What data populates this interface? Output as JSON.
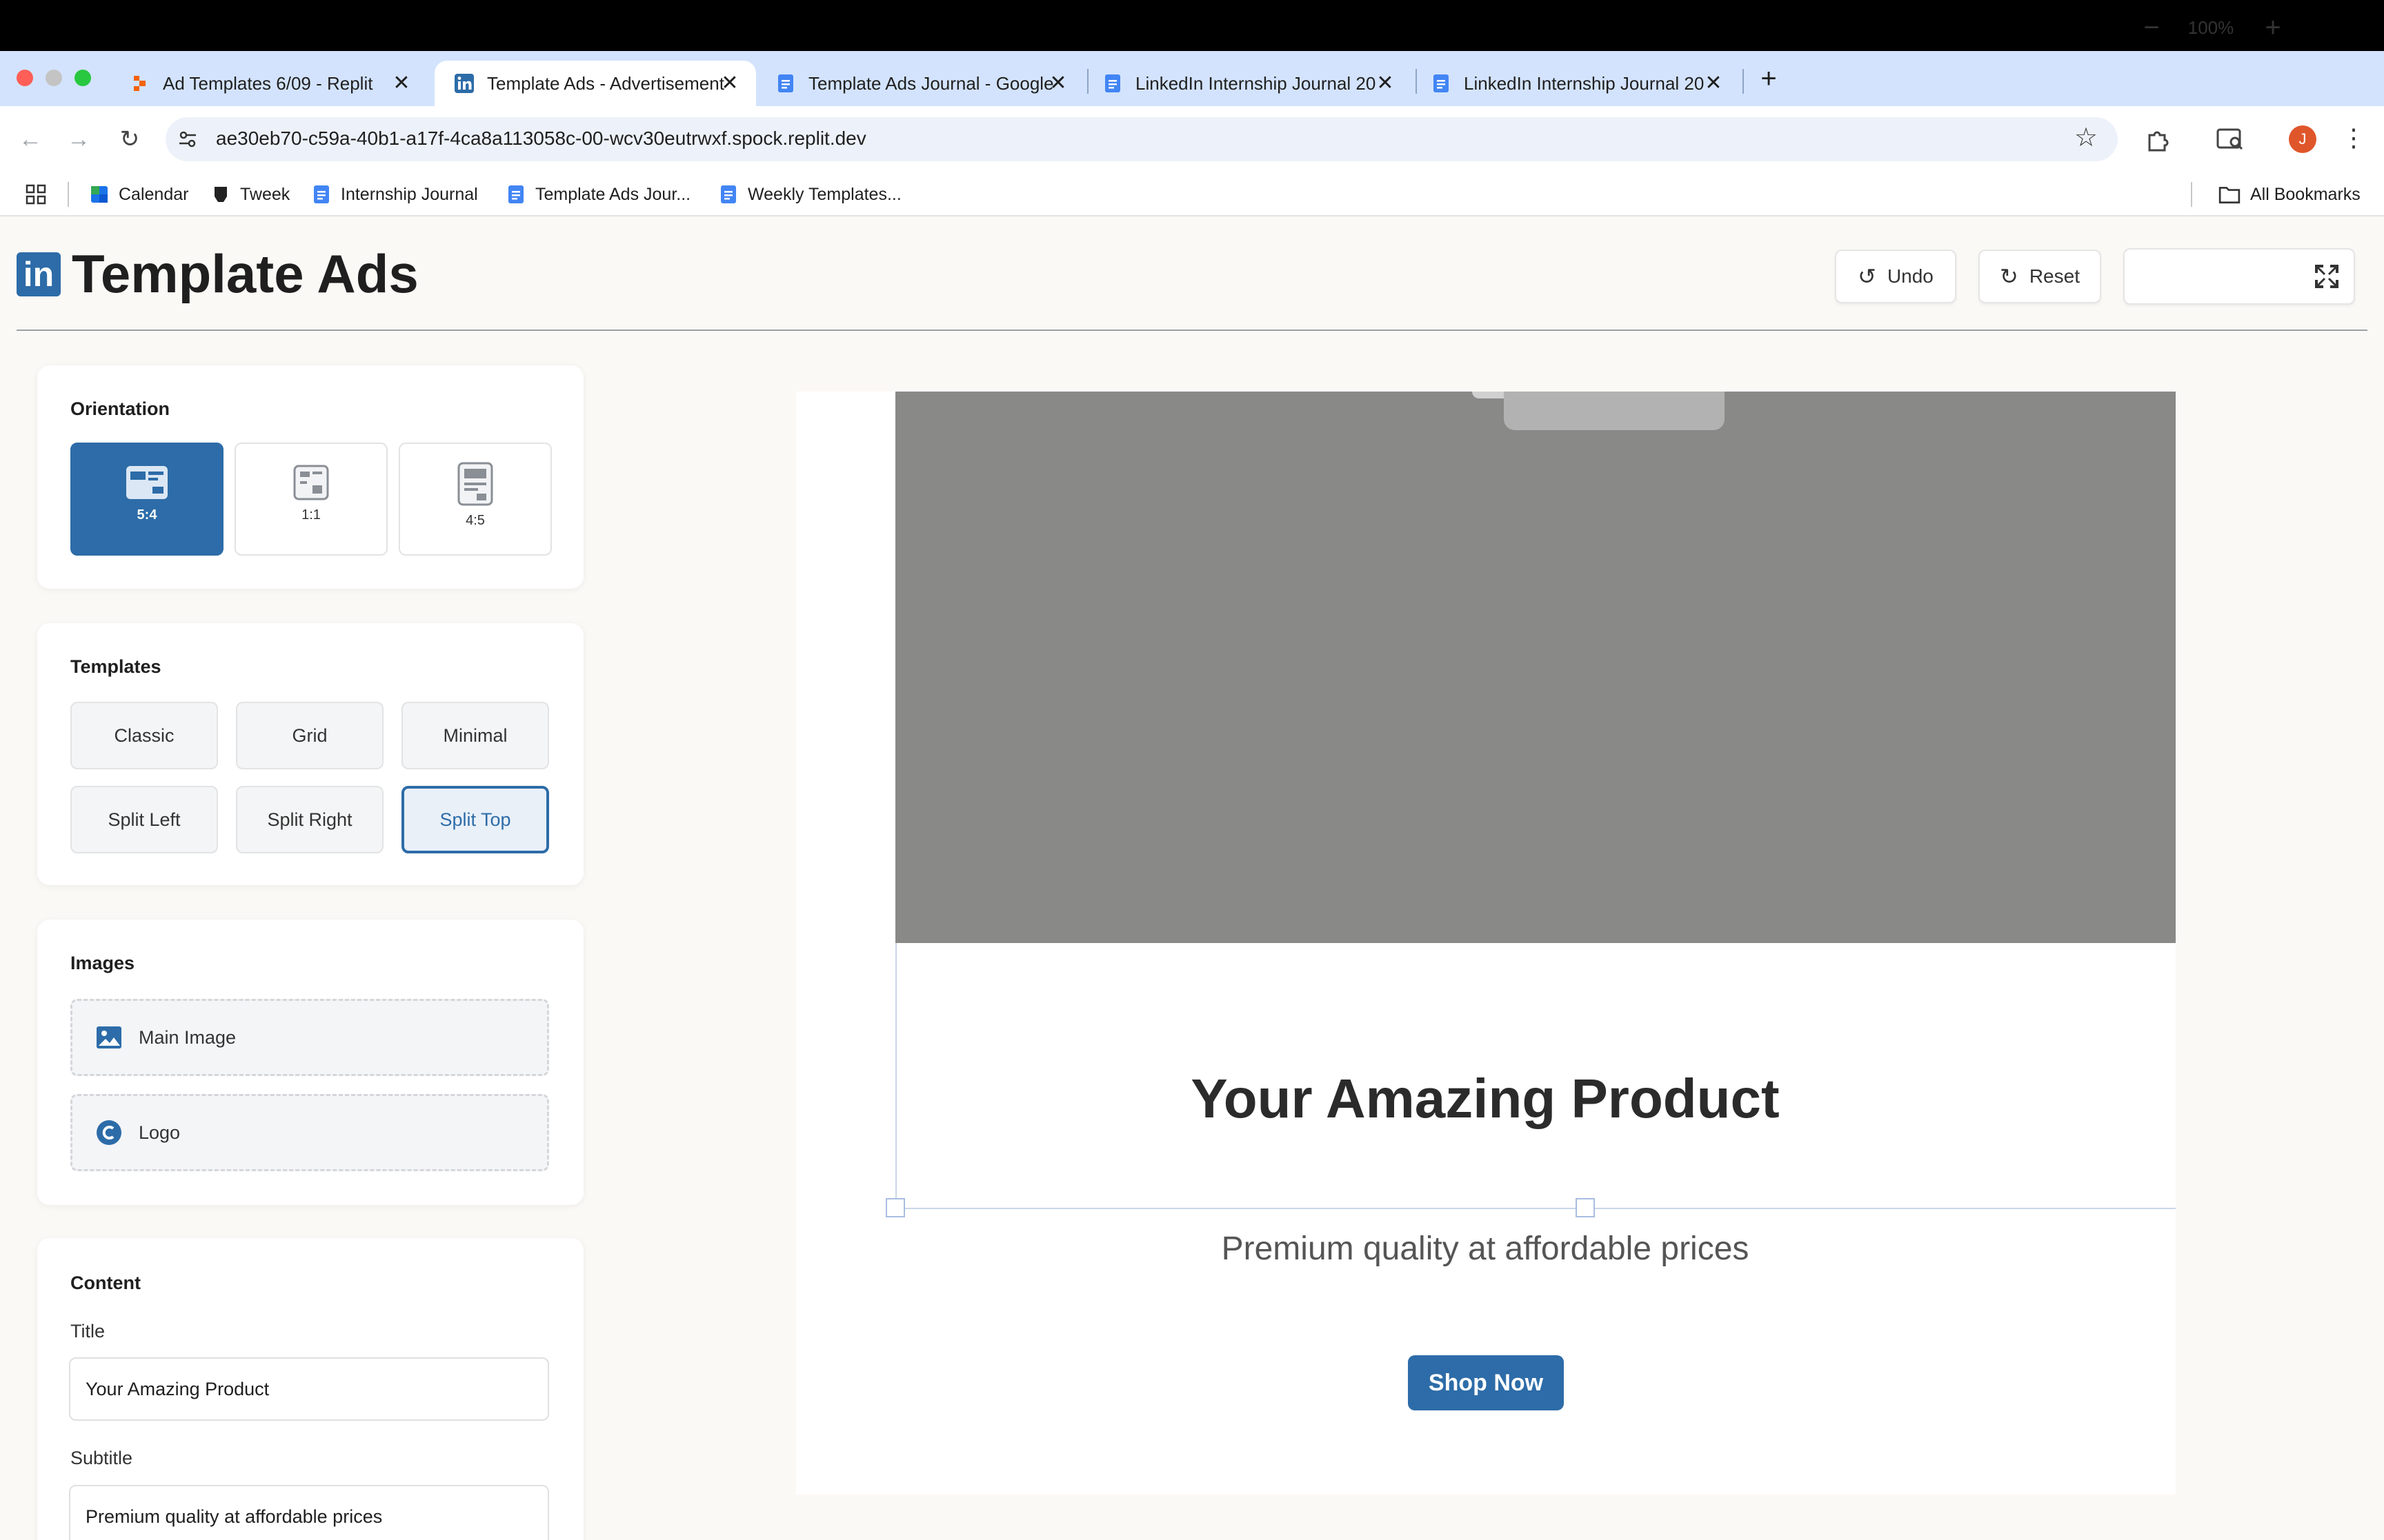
{
  "browser": {
    "tabs": [
      {
        "title": "Ad Templates 6/09 - Replit",
        "icon": "replit-icon",
        "active": false
      },
      {
        "title": "Template Ads - Advertisement",
        "icon": "linkedin-icon",
        "active": true
      },
      {
        "title": "Template Ads Journal - Google",
        "icon": "google-docs-icon",
        "active": false
      },
      {
        "title": "LinkedIn Internship Journal 20",
        "icon": "google-docs-icon",
        "active": false
      },
      {
        "title": "LinkedIn Internship Journal 20",
        "icon": "google-docs-icon",
        "active": false
      }
    ],
    "new_tab": "+",
    "close_glyph": "✕",
    "url": "ae30eb70-c59a-40b1-a17f-4ca8a113058c-00-wcv30eutrwxf.spock.replit.dev",
    "profile_initial": "J",
    "bookmarks": [
      {
        "label": "Calendar",
        "icon": "calendar-icon"
      },
      {
        "label": "Tweek",
        "icon": "tweek-icon"
      },
      {
        "label": "Internship Journal",
        "icon": "google-docs-icon"
      },
      {
        "label": "Template Ads Jour...",
        "icon": "google-docs-icon"
      },
      {
        "label": "Weekly Templates...",
        "icon": "google-docs-icon"
      }
    ],
    "all_bookmarks": "All Bookmarks"
  },
  "app": {
    "logo_text": "in",
    "title": "Template Ads",
    "undo": "Undo",
    "reset": "Reset",
    "zoom": "100%",
    "accent": "#2d6ca8"
  },
  "panels": {
    "orientation": {
      "title": "Orientation",
      "options": [
        "5:4",
        "1:1",
        "4:5"
      ],
      "selected": "5:4"
    },
    "templates": {
      "title": "Templates",
      "options": [
        "Classic",
        "Grid",
        "Minimal",
        "Split Left",
        "Split Right",
        "Split Top"
      ],
      "selected": "Split Top"
    },
    "images": {
      "title": "Images",
      "main_image": "Main Image",
      "logo": "Logo"
    },
    "content": {
      "title": "Content",
      "title_label": "Title",
      "title_value": "Your Amazing Product",
      "subtitle_label": "Subtitle",
      "subtitle_value": "Premium quality at affordable prices"
    }
  },
  "ad": {
    "title": "Your Amazing Product",
    "subtitle": "Premium quality at affordable prices",
    "cta": "Shop Now",
    "image_color": "#898988"
  }
}
